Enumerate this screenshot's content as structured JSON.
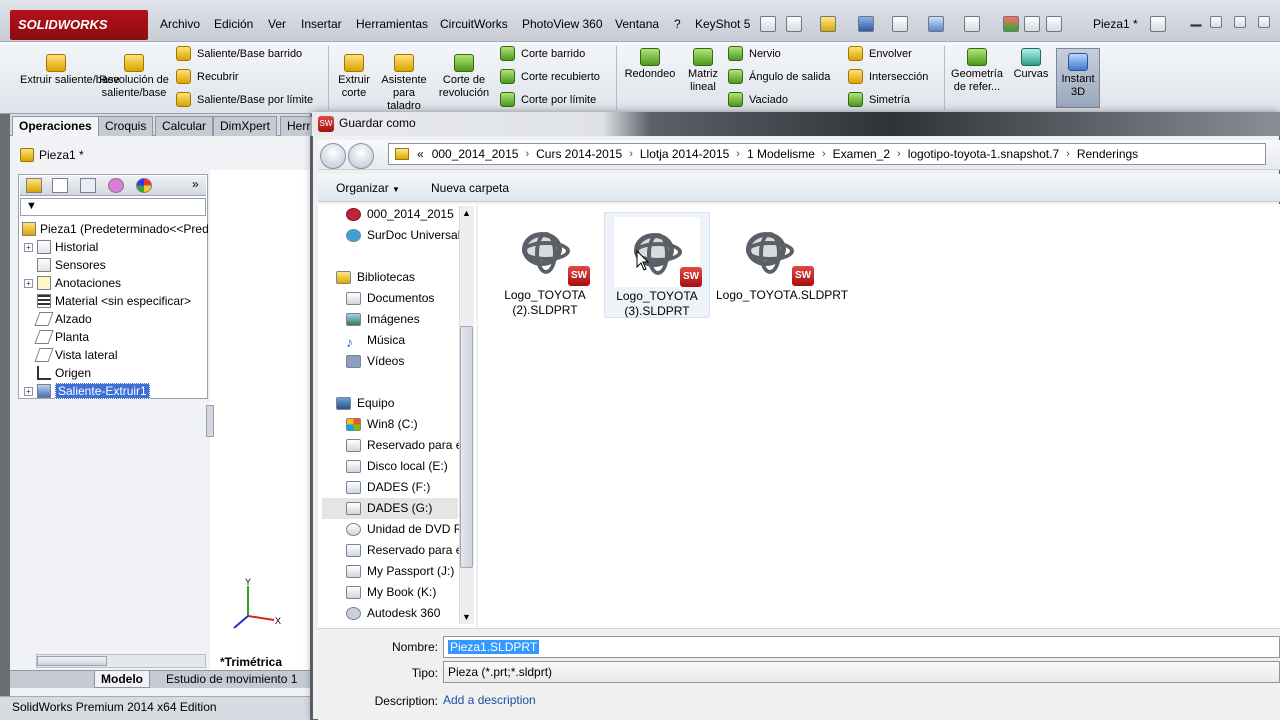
{
  "app": {
    "logo_text": "SOLIDWORKS",
    "menus": [
      "Archivo",
      "Edición",
      "Ver",
      "Insertar",
      "Herramientas",
      "CircuitWorks",
      "PhotoView 360",
      "Ventana",
      "?",
      "KeyShot 5"
    ],
    "doc_title": "Pieza1 *",
    "status": "SolidWorks Premium 2014 x64 Edition"
  },
  "ribbon": {
    "big_buttons": [
      {
        "label": "Extruir saliente/base"
      },
      {
        "label": "Revolución de saliente/base"
      }
    ],
    "small_group1": [
      "Saliente/Base barrido",
      "Recubrir",
      "Saliente/Base por límite"
    ],
    "big_buttons2": [
      {
        "label": "Extruir corte"
      },
      {
        "label": "Asistente para taladro"
      },
      {
        "label": "Corte de revolución"
      }
    ],
    "small_group2": [
      "Corte barrido",
      "Corte recubierto",
      "Corte por límite"
    ],
    "big_buttons3": [
      {
        "label": "Redondeo"
      },
      {
        "label": "Matriz lineal"
      }
    ],
    "small_group3": [
      "Nervio",
      "Ángulo de salida",
      "Vaciado"
    ],
    "small_group4": [
      "Envolver",
      "Intersección",
      "Simetría"
    ],
    "big_buttons4": [
      {
        "label": "Geometría de refer..."
      },
      {
        "label": "Curvas"
      },
      {
        "label": "Instant 3D"
      }
    ]
  },
  "cm_tabs": [
    "Operaciones",
    "Croquis",
    "Calcular",
    "DimXpert",
    "Herr"
  ],
  "feature_tree": {
    "header": "Pieza1 *",
    "items": [
      {
        "label": "Pieza1  (Predeterminado<<Pred"
      },
      {
        "label": "Historial"
      },
      {
        "label": "Sensores"
      },
      {
        "label": "Anotaciones"
      },
      {
        "label": "Material <sin especificar>"
      },
      {
        "label": "Alzado"
      },
      {
        "label": "Planta"
      },
      {
        "label": "Vista lateral"
      },
      {
        "label": "Origen"
      },
      {
        "label": "Saliente-Extruir1"
      }
    ]
  },
  "viewport": {
    "view_label": "*Trimétrica",
    "triad_x": "X",
    "triad_y": "Y"
  },
  "bottom_tabs": [
    "Modelo",
    "Estudio de movimiento 1"
  ],
  "dialog": {
    "title": "Guardar como",
    "breadcrumb": [
      "«",
      "000_2014_2015",
      "Curs 2014-2015",
      "Llotja 2014-2015",
      "1 Modelisme",
      "Examen_2",
      "logotipo-toyota-1.snapshot.7",
      "Renderings"
    ],
    "organize_label": "Organizar",
    "new_folder_label": "Nueva carpeta",
    "nav_items": [
      {
        "label": "000_2014_2015",
        "group": false
      },
      {
        "label": "SurDoc Universal",
        "group": false
      },
      {
        "label": "Bibliotecas",
        "group": true
      },
      {
        "label": "Documentos",
        "group": false
      },
      {
        "label": "Imágenes",
        "group": false
      },
      {
        "label": "Música",
        "group": false
      },
      {
        "label": "Vídeos",
        "group": false
      },
      {
        "label": "Equipo",
        "group": true
      },
      {
        "label": "Win8 (C:)",
        "group": false
      },
      {
        "label": "Reservado para e",
        "group": false
      },
      {
        "label": "Disco local (E:)",
        "group": false
      },
      {
        "label": "DADES (F:)",
        "group": false
      },
      {
        "label": "DADES (G:)",
        "group": false
      },
      {
        "label": "Unidad de DVD R",
        "group": false
      },
      {
        "label": "Reservado para e",
        "group": false
      },
      {
        "label": "My Passport (J:)",
        "group": false
      },
      {
        "label": "My Book (K:)",
        "group": false
      },
      {
        "label": "Autodesk 360",
        "group": false
      }
    ],
    "files": [
      {
        "name": "Logo_TOYOTA (2).SLDPRT"
      },
      {
        "name": "Logo_TOYOTA (3).SLDPRT"
      },
      {
        "name": "Logo_TOYOTA.SLDPRT"
      }
    ],
    "badge_text": "SW",
    "name_label": "Nombre:",
    "name_value": "Pieza1.SLDPRT",
    "type_label": "Tipo:",
    "type_value": "Pieza (*.prt;*.sldprt)",
    "description_label": "Description:",
    "description_link": "Add a description"
  }
}
